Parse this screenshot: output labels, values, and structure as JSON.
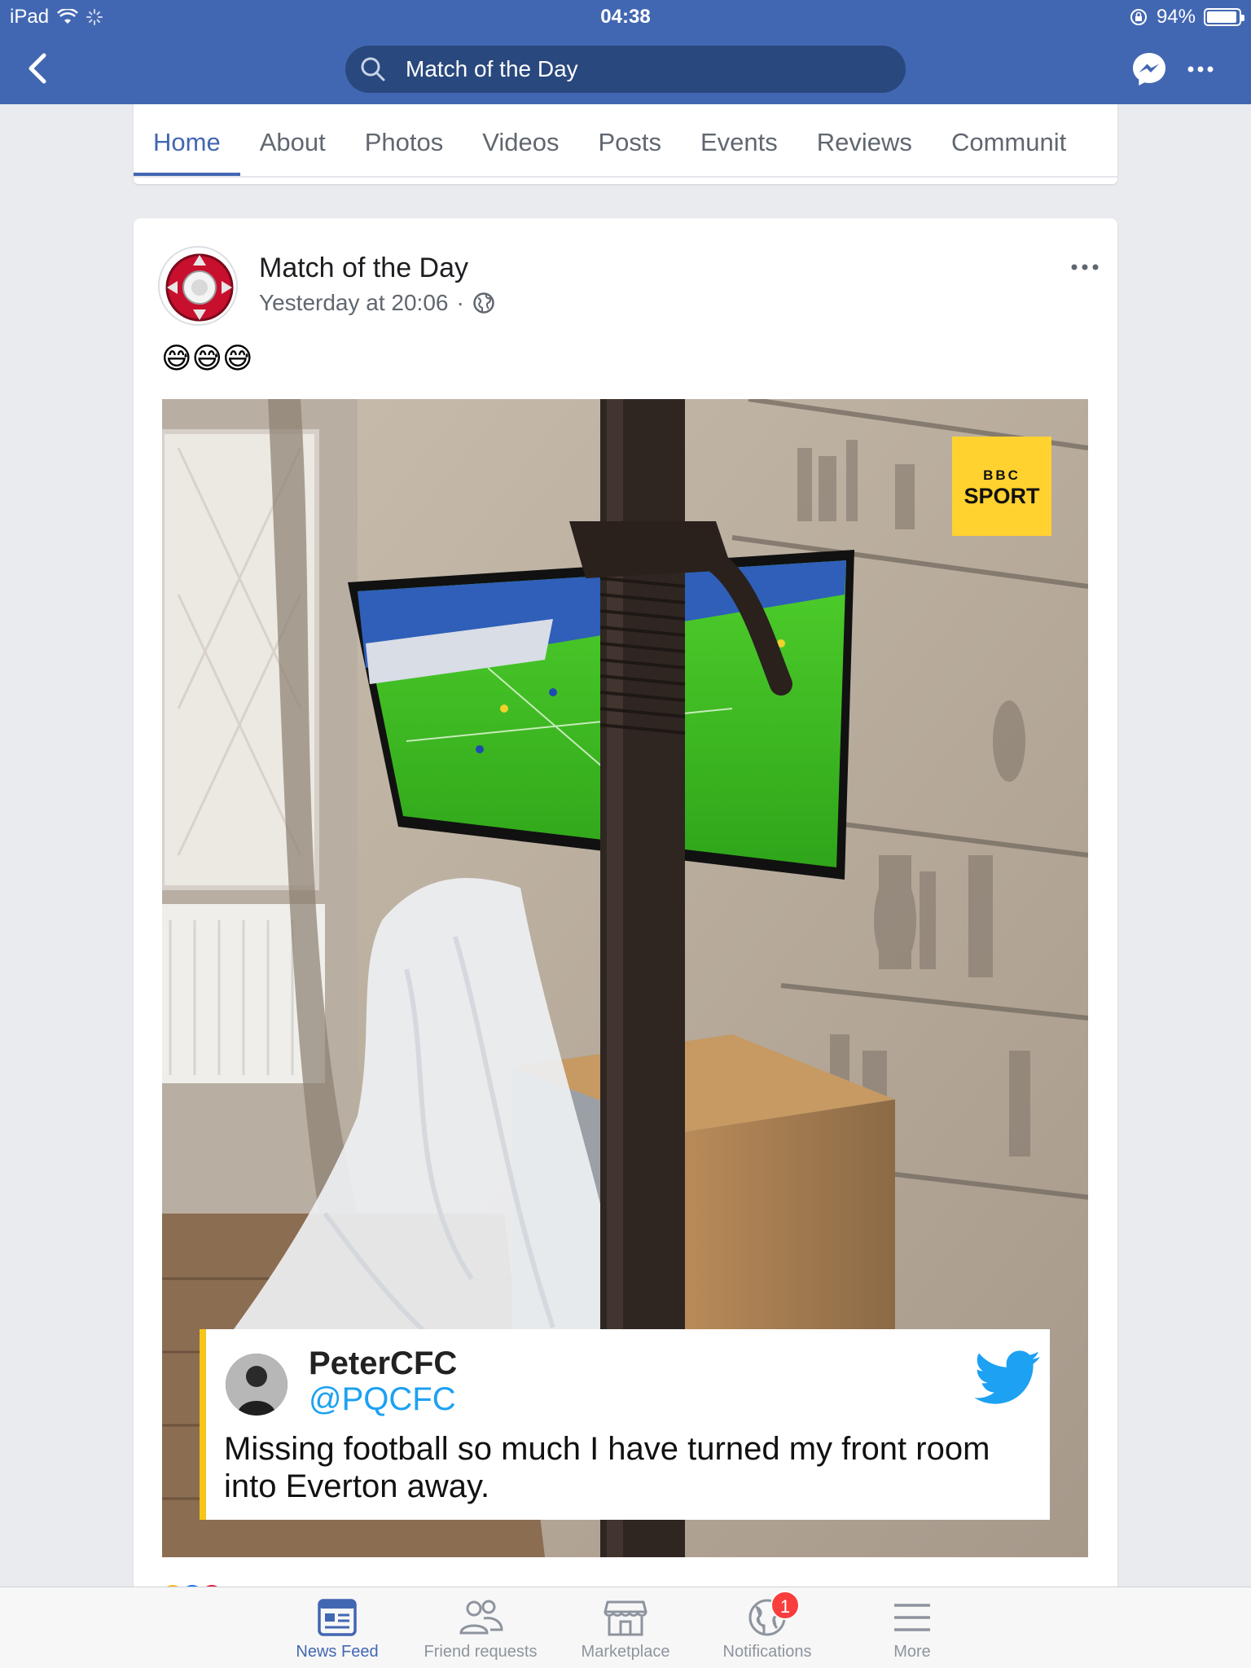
{
  "status_bar": {
    "device": "iPad",
    "time": "04:38",
    "battery_text": "94%",
    "battery_level": 0.94
  },
  "header": {
    "search_query": "Match of the Day",
    "icons": [
      "back-icon",
      "search-icon",
      "messenger-icon",
      "more-icon"
    ]
  },
  "tabs": [
    {
      "label": "Home",
      "active": true
    },
    {
      "label": "About"
    },
    {
      "label": "Photos"
    },
    {
      "label": "Videos"
    },
    {
      "label": "Posts"
    },
    {
      "label": "Events"
    },
    {
      "label": "Reviews"
    },
    {
      "label": "Communit"
    }
  ],
  "post": {
    "page_name": "Match of the Day",
    "timestamp": "Yesterday at 20:06",
    "separator": "·",
    "emoji_text": "😅😅😅",
    "image": {
      "badge_line1": "BBC",
      "badge_line2": "SPORT",
      "badge_color": "#ffd230",
      "tweet": {
        "name": "PeterCFC",
        "handle": "@PQCFC",
        "text": "Missing football so much I have turned my front room into Everton away."
      }
    }
  },
  "bottom_nav": [
    {
      "label": "News Feed",
      "icon": "news-feed-icon",
      "active": true
    },
    {
      "label": "Friend requests",
      "icon": "friends-icon"
    },
    {
      "label": "Marketplace",
      "icon": "marketplace-icon"
    },
    {
      "label": "Notifications",
      "icon": "globe-icon",
      "badge": "1"
    },
    {
      "label": "More",
      "icon": "menu-icon"
    }
  ],
  "colors": {
    "brand_blue": "#4267b2",
    "search_bg": "#29487d",
    "badge_red": "#fa3e3e",
    "twitter_blue": "#1da1f2"
  }
}
